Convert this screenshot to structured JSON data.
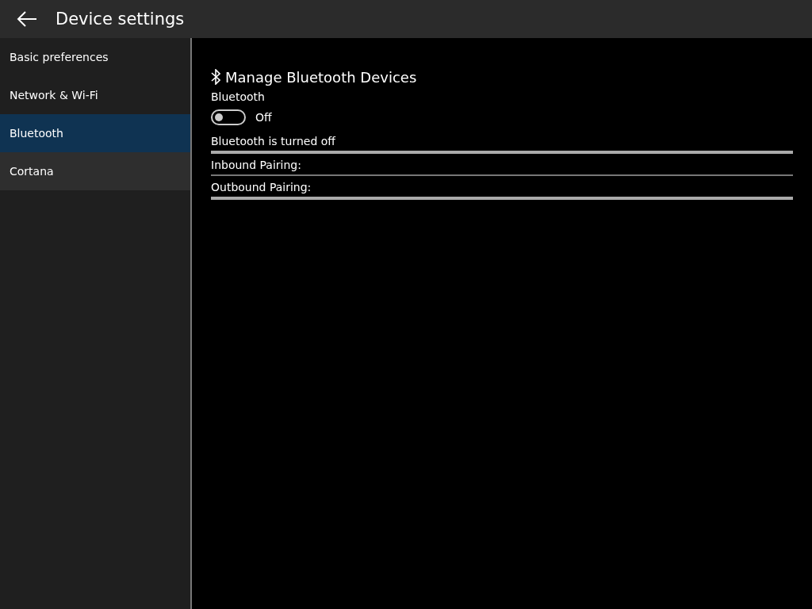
{
  "header": {
    "title": "Device settings"
  },
  "sidebar": {
    "items": [
      {
        "label": "Basic preferences",
        "selected": false,
        "hovered": false
      },
      {
        "label": "Network & Wi-Fi",
        "selected": false,
        "hovered": false
      },
      {
        "label": "Bluetooth",
        "selected": true,
        "hovered": false
      },
      {
        "label": "Cortana",
        "selected": false,
        "hovered": true
      }
    ]
  },
  "content": {
    "title": "Manage Bluetooth Devices",
    "toggle": {
      "label": "Bluetooth",
      "on": false,
      "state_text": "Off"
    },
    "status": "Bluetooth is turned off",
    "fields": [
      {
        "label": "Inbound Pairing:"
      },
      {
        "label": "Outbound Pairing:"
      }
    ]
  }
}
